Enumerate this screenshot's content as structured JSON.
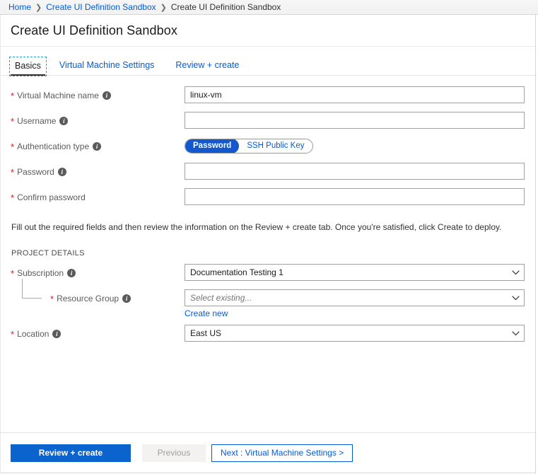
{
  "breadcrumb": {
    "items": [
      {
        "label": "Home",
        "link": true
      },
      {
        "label": "Create UI Definition Sandbox",
        "link": true
      },
      {
        "label": "Create UI Definition Sandbox",
        "link": false
      }
    ],
    "separator": "❯"
  },
  "blade": {
    "title": "Create UI Definition Sandbox"
  },
  "tabs": [
    {
      "label": "Basics",
      "active": true
    },
    {
      "label": "Virtual Machine Settings",
      "active": false
    },
    {
      "label": "Review + create",
      "active": false
    }
  ],
  "form": {
    "vm_name": {
      "label": "Virtual Machine name",
      "required_marker": "*",
      "info": "i",
      "value": "linux-vm",
      "placeholder": ""
    },
    "username": {
      "label": "Username",
      "required_marker": "*",
      "info": "i",
      "value": "",
      "placeholder": ""
    },
    "auth_type": {
      "label": "Authentication type",
      "required_marker": "*",
      "info": "i",
      "options": [
        {
          "label": "Password",
          "selected": true
        },
        {
          "label": "SSH Public Key",
          "selected": false
        }
      ]
    },
    "password": {
      "label": "Password",
      "required_marker": "*",
      "info": "i",
      "value": "",
      "placeholder": ""
    },
    "confirm_password": {
      "label": "Confirm password",
      "required_marker": "*",
      "value": "",
      "placeholder": ""
    },
    "help_text": "Fill out the required fields and then review the information on the Review + create tab. Once you're satisfied, click Create to deploy.",
    "project_details_heading": "PROJECT DETAILS",
    "subscription": {
      "label": "Subscription",
      "required_marker": "*",
      "info": "i",
      "value": "Documentation Testing 1"
    },
    "resource_group": {
      "label": "Resource Group",
      "required_marker": "*",
      "info": "i",
      "value": "",
      "placeholder": "Select existing...",
      "create_new_link": "Create new"
    },
    "location": {
      "label": "Location",
      "required_marker": "*",
      "info": "i",
      "value": "East US"
    }
  },
  "footer": {
    "review_create": "Review + create",
    "previous": "Previous",
    "next": "Next : Virtual Machine Settings >"
  },
  "colors": {
    "accent_blue": "#0b63ce",
    "link_blue": "#015cda",
    "pill_selected": "#1359cd",
    "required_red": "#e81123",
    "text_dark": "#1b1a19",
    "label_gray": "#5a5a5a",
    "border_gray": "#a0a0a0",
    "disabled_bg": "#f3f2f1",
    "disabled_text": "#a19f9d"
  }
}
